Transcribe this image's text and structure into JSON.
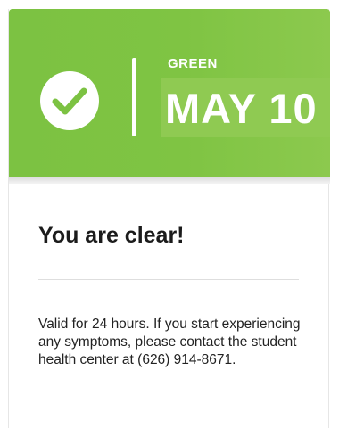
{
  "card": {
    "status": "GREEN",
    "date": "MAY 10",
    "check_icon": "check-circle-icon",
    "headline": "You are clear!",
    "message": "Valid for 24 hours. If you start experiencing any symptoms, please contact the student health center at (626) 914-8671."
  },
  "colors": {
    "banner_green": "#7cc242",
    "text_dark": "#1b1b1b"
  }
}
